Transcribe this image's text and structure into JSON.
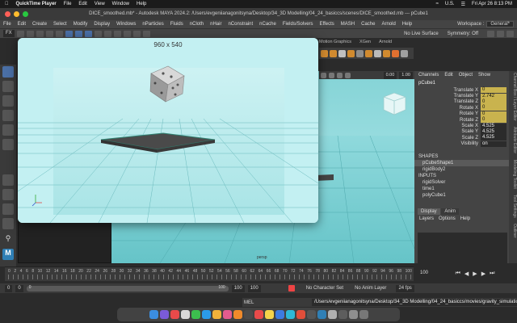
{
  "menubar": {
    "app": "QuickTime Player",
    "items": [
      "File",
      "Edit",
      "View",
      "Window",
      "Help"
    ],
    "input_source": "U.S.",
    "datetime": "Fri Apr 26 8:13 PM"
  },
  "maya": {
    "title": "DICE_smoothed.mb* - Autodesk MAYA 2024.2: /Users/evgeniianagonitsyna/Desktop/34_3D Modelling/04_24_basiccs/scenes/DICE_smoothed.mb  ---  pCube1",
    "menu": [
      "File",
      "Edit",
      "Create",
      "Select",
      "Modify",
      "Display",
      "Windows",
      "nParticles",
      "Fluids",
      "nCloth",
      "nHair",
      "nConstraint",
      "nCache",
      "Fields/Solvers",
      "Effects",
      "MASH",
      "Cache",
      "Arnold",
      "Help"
    ],
    "workspace_label": "Workspace :",
    "workspace_value": "General*",
    "status": {
      "mode": "FX",
      "live_surface": "No Live Surface",
      "symmetry": "Symmetry: Off"
    },
    "shelf_tabs": [
      "Motion Graphics",
      "XGen",
      "Arnold"
    ],
    "viewport_header": {
      "field1": "0.00",
      "field2": "1.00"
    },
    "viewport_label": "persp",
    "channel_box": {
      "menu": [
        "Channels",
        "Edit",
        "Object",
        "Show"
      ],
      "object": "pCube1",
      "attributes": [
        {
          "name": "Translate X",
          "value": "0",
          "keyed": true
        },
        {
          "name": "Translate Y",
          "value": "2.742",
          "keyed": true
        },
        {
          "name": "Translate Z",
          "value": "0",
          "keyed": true
        },
        {
          "name": "Rotate X",
          "value": "0",
          "keyed": true
        },
        {
          "name": "Rotate Y",
          "value": "0",
          "keyed": true
        },
        {
          "name": "Rotate Z",
          "value": "0",
          "keyed": true
        },
        {
          "name": "Scale X",
          "value": "4.525",
          "keyed": false
        },
        {
          "name": "Scale Y",
          "value": "4.525",
          "keyed": false
        },
        {
          "name": "Scale Z",
          "value": "4.525",
          "keyed": false
        },
        {
          "name": "Visibility",
          "value": "on",
          "keyed": false
        }
      ],
      "shapes_label": "SHAPES",
      "shapes": [
        "pCubeShape1",
        "rigidBody2"
      ],
      "inputs_label": "INPUTS",
      "inputs": [
        "rigidSolver",
        "time1",
        "polyCube1"
      ]
    },
    "side_tabs": [
      "Channel Box / Layer Editor",
      "Attribute Editor",
      "Modeling Toolkit",
      "Tool Settings",
      "Outliner"
    ],
    "layer_editor": {
      "tabs": [
        "Display",
        "Anim"
      ],
      "menu": [
        "Layers",
        "Options",
        "Help"
      ]
    },
    "timeline": {
      "ticks": [
        "0",
        "2",
        "4",
        "6",
        "8",
        "10",
        "12",
        "14",
        "16",
        "18",
        "20",
        "22",
        "24",
        "26",
        "28",
        "30",
        "32",
        "34",
        "36",
        "38",
        "40",
        "42",
        "44",
        "46",
        "48",
        "50",
        "52",
        "54",
        "56",
        "58",
        "60",
        "62",
        "64",
        "66",
        "68",
        "70",
        "72",
        "74",
        "76",
        "78",
        "80",
        "82",
        "84",
        "86",
        "88",
        "90",
        "92",
        "94",
        "96",
        "98",
        "100"
      ],
      "current_frame": "100"
    },
    "range": {
      "start": "0",
      "inner_start": "0",
      "slider_left": "0",
      "slider_right": "100",
      "inner_end": "100",
      "end": "100",
      "character_set": "No Character Set",
      "anim_layer": "No Anim Layer",
      "fps": "24 fps"
    },
    "mel": {
      "label": "MEL",
      "output": "/Users/evgeniianagonitsyna/Desktop/34_3D Modelling/04_24_basiccs/movies/gravity_simulation.mov"
    }
  },
  "quicktime": {
    "caption": "960 x 540"
  },
  "colors": {
    "accent": "#4a6fa5",
    "keyed": "#c9b34e",
    "viewport_sky": "#a8e4e6"
  }
}
